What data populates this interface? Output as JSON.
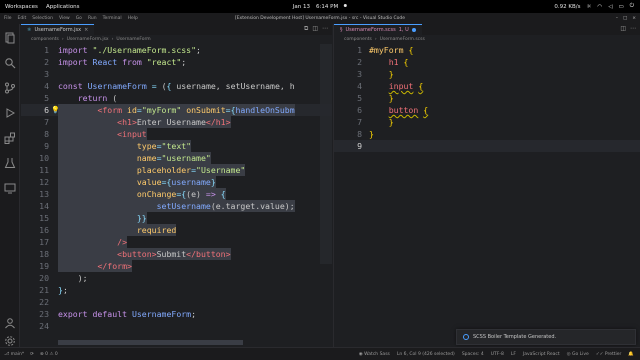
{
  "topbar": {
    "workspaces": "Workspaces",
    "applications": "Applications",
    "date": "Jan 13",
    "time": "6:14 PM",
    "net": "0.92 KB/s"
  },
  "titlebar": {
    "menus": [
      "File",
      "Edit",
      "Selection",
      "View",
      "Go",
      "Run",
      "Terminal",
      "Help"
    ],
    "title": "[Extension Development Host] UsernameForm.jsx - src - Visual Studio Code"
  },
  "left_editor": {
    "tab_label": "UsernameForm.jsx",
    "breadcrumbs": [
      "components",
      "UsernameForm.jsx",
      "UsernameForm"
    ],
    "lines": [
      {
        "n": "1",
        "html": "<span class='k'>import</span> <span class='s'>\"./UsernameForm.scss\"</span><span class='p'>;</span>"
      },
      {
        "n": "2",
        "html": "<span class='k'>import</span> <span class='v'>React</span> <span class='k'>from</span> <span class='s'>\"react\"</span><span class='p'>;</span>"
      },
      {
        "n": "3",
        "html": ""
      },
      {
        "n": "4",
        "html": "<span class='k'>const</span> <span class='v'>UsernameForm</span> <span class='b'>=</span> <span class='p'>(</span><span class='b'>{</span> <span class='p'>username, setUsername, h</span>"
      },
      {
        "n": "5",
        "html": "    <span class='k'>return</span> <span class='p'>(</span>"
      },
      {
        "n": "6",
        "html": "        <span class='t'>&lt;form</span> <span class='a'>id</span><span class='b'>=</span><span class='s'>\"myForm\"</span> <span class='a'>onSubmit</span><span class='b'>={</span><span class='v'>handleOnSubm</span>"
      },
      {
        "n": "7",
        "html": "            <span class='t'>&lt;h1&gt;</span><span class='p'>Enter Username</span><span class='t'>&lt;/h1&gt;</span>"
      },
      {
        "n": "8",
        "html": "            <span class='t'>&lt;input</span>"
      },
      {
        "n": "9",
        "html": "                <span class='a'>type</span><span class='b'>=</span><span class='s'>\"text\"</span>"
      },
      {
        "n": "10",
        "html": "                <span class='a'>name</span><span class='b'>=</span><span class='s'>\"username\"</span>"
      },
      {
        "n": "11",
        "html": "                <span class='a'>placeholder</span><span class='b'>=</span><span class='s'>\"Username\"</span>"
      },
      {
        "n": "12",
        "html": "                <span class='a'>value</span><span class='b'>={</span><span class='v'>username</span><span class='b'>}</span>"
      },
      {
        "n": "13",
        "html": "                <span class='a'>onChange</span><span class='b'>={</span><span class='p'>(e)</span> <span class='k'>=&gt;</span> <span class='b'>{</span>"
      },
      {
        "n": "14",
        "html": "                    <span class='v'>setUsername</span><span class='p'>(e.target.value);</span>"
      },
      {
        "n": "15",
        "html": "                <span class='b'>}}</span>"
      },
      {
        "n": "16",
        "html": "                <span class='a'>required</span>"
      },
      {
        "n": "17",
        "html": "            <span class='t'>/&gt;</span>"
      },
      {
        "n": "18",
        "html": "            <span class='t'>&lt;button&gt;</span><span class='p'>Submit</span><span class='t'>&lt;/button&gt;</span>"
      },
      {
        "n": "19",
        "html": "        <span class='t'>&lt;/form&gt;</span>"
      },
      {
        "n": "20",
        "html": "    <span class='p'>);</span>"
      },
      {
        "n": "21",
        "html": "<span class='b'>}</span><span class='p'>;</span>"
      },
      {
        "n": "22",
        "html": ""
      },
      {
        "n": "23",
        "html": "<span class='k'>export default</span> <span class='v'>UsernameForm</span><span class='p'>;</span>"
      },
      {
        "n": "24",
        "html": ""
      }
    ]
  },
  "right_editor": {
    "tab_label": "UsernameForm.scss",
    "tab_badge": "1, U",
    "breadcrumbs": [
      "components",
      "UsernameForm.scss"
    ],
    "lines": [
      {
        "n": "1",
        "html": "<span class='sel-id'>#myForm</span> <span class='y'>{</span>"
      },
      {
        "n": "2",
        "html": "    <span class='sel-tag'>h1</span> <span class='y'>{</span>"
      },
      {
        "n": "3",
        "html": "    <span class='y'>}</span>"
      },
      {
        "n": "4",
        "html": "    <span class='sel-tag squig'>input</span> <span class='y squig'>{</span>"
      },
      {
        "n": "5",
        "html": "    <span class='y'>}</span>"
      },
      {
        "n": "6",
        "html": "    <span class='sel-tag squig'>button</span> <span class='y squig'>{</span>"
      },
      {
        "n": "7",
        "html": "    <span class='y'>}</span>"
      },
      {
        "n": "8",
        "html": "<span class='y'>}</span>"
      },
      {
        "n": "9",
        "html": ""
      }
    ]
  },
  "notification": {
    "message": "SCSS Boiler Template Generated."
  },
  "statusbar": {
    "branch": "main*",
    "errors": "0",
    "warnings": "0",
    "watch": "Watch Sass",
    "position": "Ln 6, Col 9 (426 selected)",
    "spaces": "Spaces: 4",
    "encoding": "UTF-8",
    "eol": "LF",
    "language": "JavaScript React",
    "golive": "Go Live",
    "prettier": "Prettier"
  }
}
